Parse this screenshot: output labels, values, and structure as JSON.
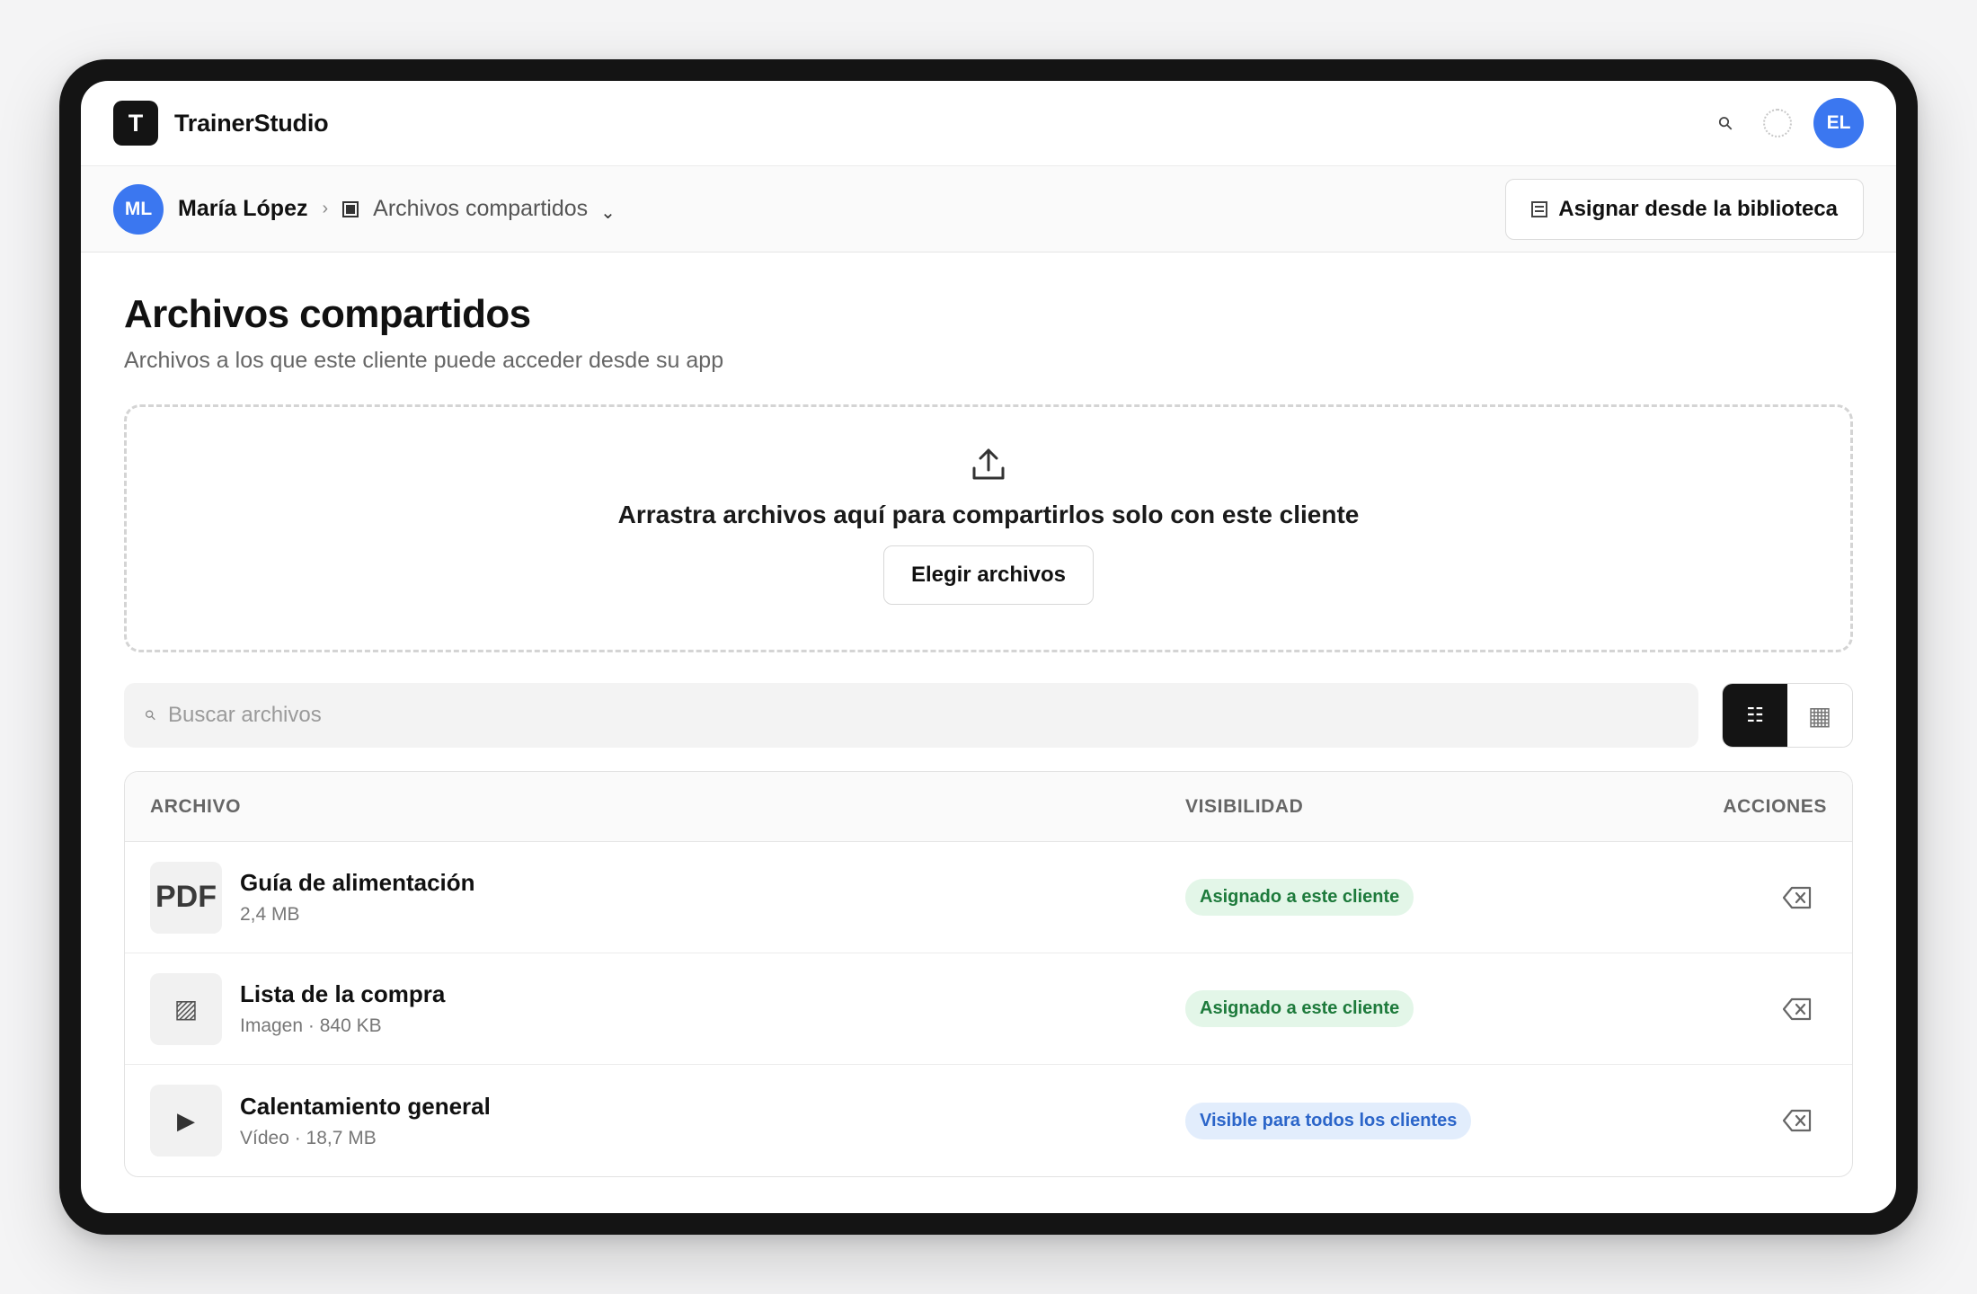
{
  "app": {
    "logo_letter": "T",
    "brand": "TrainerStudio",
    "user_initials": "EL",
    "accent_color": "#3b77f0"
  },
  "subheader": {
    "client_initials": "ML",
    "client_name": "María López",
    "separator": "›",
    "current_section": "Archivos compartidos",
    "dropdown_glyph": "⌄",
    "library_button": "Asignar desde la biblioteca"
  },
  "page": {
    "title": "Archivos compartidos",
    "subtitle": "Archivos a los que este cliente puede acceder desde su app"
  },
  "dropzone": {
    "text": "Arrastra archivos aquí para compartirlos solo con este cliente",
    "button": "Elegir archivos"
  },
  "search": {
    "placeholder": "Buscar archivos",
    "value": ""
  },
  "view_toggle": {
    "selected": "list"
  },
  "table": {
    "headers": {
      "file": "ARCHIVO",
      "visibility": "VISIBILIDAD",
      "actions": "ACCIONES"
    },
    "rows": [
      {
        "thumb": "PDF",
        "icon": "pdf-icon",
        "name": "Guía de alimentación",
        "info": "2,4 MB",
        "visibility": "Asignado a este cliente",
        "visibility_color": "#1d7a3b"
      },
      {
        "thumb": "▨",
        "icon": "image-icon",
        "name": "Lista de la compra",
        "info": "Imagen · 840 KB",
        "visibility": "Asignado a este cliente",
        "visibility_color": "#1d7a3b"
      },
      {
        "thumb": "▶",
        "icon": "video-icon",
        "name": "Calentamiento general",
        "info": "Vídeo · 18,7 MB",
        "visibility": "Visible para todos los clientes",
        "visibility_color": "#2b65c9"
      }
    ]
  }
}
